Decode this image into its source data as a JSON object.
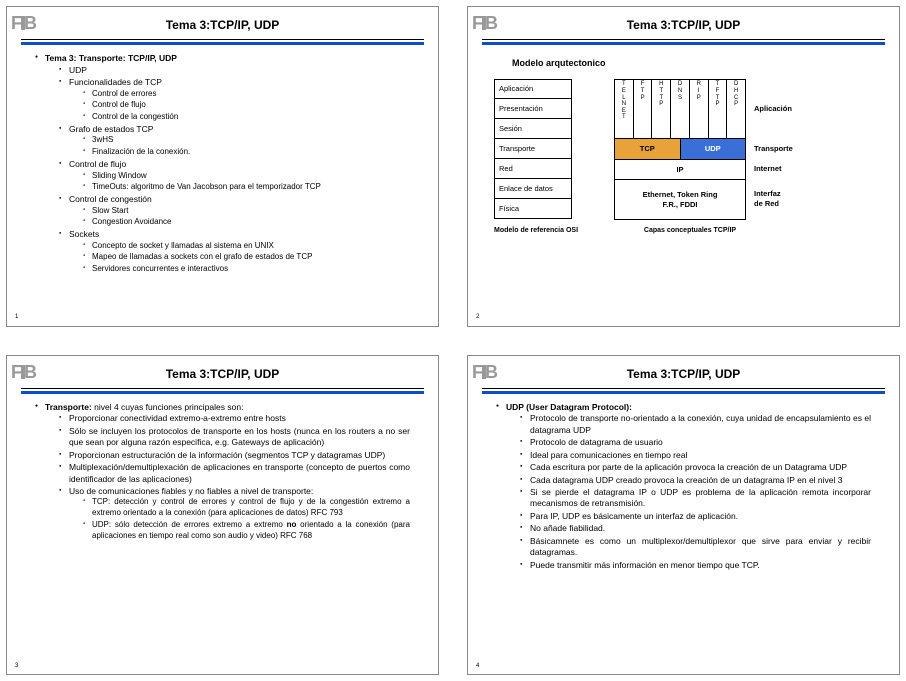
{
  "common": {
    "title": "Tema 3:TCP/IP, UDP"
  },
  "slide1": {
    "num": "1",
    "heading": "Tema 3: Transporte: TCP/IP, UDP",
    "i1": "UDP",
    "i2": "Funcionalidades de TCP",
    "i2a": "Control de errores",
    "i2b": "Control de flujo",
    "i2c": "Control de la congestión",
    "i3": "Grafo de estados TCP",
    "i3a": "3wHS",
    "i3b": "Finalización de la conexión.",
    "i4": "Control de flujo",
    "i4a": "Sliding Window",
    "i4b": "TimeOuts: algoritmo de Van Jacobson para el temporizador TCP",
    "i5": "Control de congestión",
    "i5a": "Slow Start",
    "i5b": "Congestion Avoidance",
    "i6": "Sockets",
    "i6a": "Concepto de socket y llamadas al sistema en UNIX",
    "i6b": "Mapeo de llamadas a sockets con el grafo de estados de TCP",
    "i6c": "Servidores concurrentes e interactivos"
  },
  "slide2": {
    "num": "2",
    "archTitle": "Modelo arqutectonico",
    "osi": {
      "l1": "Aplicación",
      "l2": "Presentación",
      "l3": "Sesión",
      "l4": "Transporte",
      "l5": "Red",
      "l6": "Enlace de datos",
      "l7": "Física"
    },
    "tcp": "TCP",
    "udp": "UDP",
    "ip": "IP",
    "eth1": "Ethernet, Token Ring",
    "eth2": "F.R., FDDI",
    "rlab1": "Aplicación",
    "rlab2": "Transporte",
    "rlab3": "Internet",
    "rlab4a": "Interfaz",
    "rlab4b": "de Red",
    "cap1": "Modelo de referencia OSI",
    "cap2": "Capas conceptuales TCP/IP",
    "p": {
      "telnet": "TELNET",
      "ftp": "FTP",
      "http": "HTTP",
      "dns": "DNS",
      "rip": "RIP",
      "tftp": "TFTP",
      "dhcp": "DHCP"
    }
  },
  "slide3": {
    "num": "3",
    "lead_b": "Transporte:",
    "lead_r": " nivel 4 cuyas funciones principales son:",
    "a": "Proporcionar conectividad extremo-a-extremo entre hosts",
    "b": "Sólo se incluyen los protocolos de transporte en los hosts (nunca en los routers a no ser que sean por alguna razón especifica, e.g. Gateways de aplicación)",
    "c": "Proporcionan estructuración de la información (segmentos TCP y datagramas UDP)",
    "d": "Multiplexación/demultiplexación de aplicaciones en transporte (concepto de puertos como identificador de las aplicaciones)",
    "e": "Uso de comunicaciones fiables y no fiables a nivel de transporte:",
    "e1": "TCP: detección y control de errores y control de flujo y de la congestión extremo a extremo orientado a la conexión (para aplicaciones de datos) RFC 793",
    "e2a": "UDP: sólo detección de errores extremo a extremo ",
    "e2b": "no",
    "e2c": " orientado a la conexión (para aplicaciones en tiempo real como son audio y video) RFC 768"
  },
  "slide4": {
    "num": "4",
    "head": "UDP (User Datagram Protocol):",
    "a": "Protocolo de transporte no-orientado a la conexión, cuya unidad de encapsulamiento es el datagrama UDP",
    "b": "Protocolo de datagrama de usuario",
    "c": "Ideal para comunicaciones en tiempo real",
    "d": "Cada escritura por parte de la aplicación provoca la creación de un Datagrama UDP",
    "e": "Cada datagrama UDP creado provoca la creación de un datagrama IP en el nivel 3",
    "f": "Si se pierde el datagrama IP o UDP es problema de la aplicación remota incorporar mecanismos de retransmisión.",
    "g": "Para IP, UDP es básicamente un interfaz de aplicación.",
    "h": "No añade fiabilidad.",
    "i": "Básicamnete es como un multiplexor/demultiplexor que sirve para enviar y recibir datagramas.",
    "j": "Puede transmitir más información en menor tiempo que TCP."
  }
}
